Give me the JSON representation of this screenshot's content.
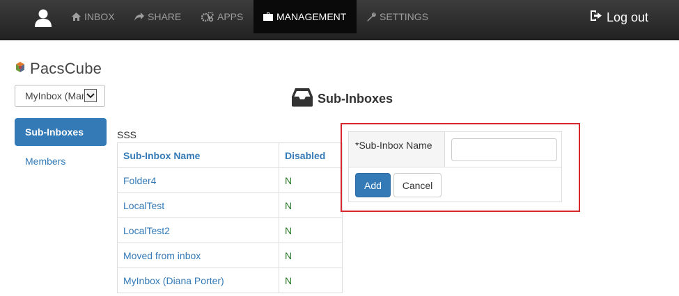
{
  "navbar": {
    "user_icon": "user-icon",
    "items": [
      {
        "label": "INBOX",
        "icon": "home-icon"
      },
      {
        "label": "SHARE",
        "icon": "share-icon"
      },
      {
        "label": "APPS",
        "icon": "cogs-icon"
      },
      {
        "label": "MANAGEMENT",
        "icon": "briefcase-icon",
        "active": true
      },
      {
        "label": "SETTINGS",
        "icon": "wrench-icon"
      }
    ],
    "logout_label": "Log out"
  },
  "sidebar": {
    "logo_text": "PacsCube",
    "inbox_select_value": "MyInbox (Mar",
    "nav": [
      {
        "label": "Sub-Inboxes",
        "active": true
      },
      {
        "label": "Members"
      }
    ]
  },
  "main": {
    "heading": "Sub-Inboxes",
    "table_caption": "SSS",
    "columns": [
      "Sub-Inbox Name",
      "Disabled"
    ],
    "rows": [
      {
        "name": "Folder4",
        "disabled": "N"
      },
      {
        "name": "LocalTest",
        "disabled": "N"
      },
      {
        "name": "LocalTest2",
        "disabled": "N"
      },
      {
        "name": "Moved from inbox",
        "disabled": "N"
      },
      {
        "name": "MyInbox (Diana Porter)",
        "disabled": "N"
      }
    ]
  },
  "form": {
    "label": "*Sub-Inbox Name",
    "input_value": "",
    "add_label": "Add",
    "cancel_label": "Cancel"
  },
  "colors": {
    "accent": "#337ab7",
    "navbar": "#222222",
    "highlight": "#d9272e",
    "flag_text": "#2a7a2a"
  }
}
